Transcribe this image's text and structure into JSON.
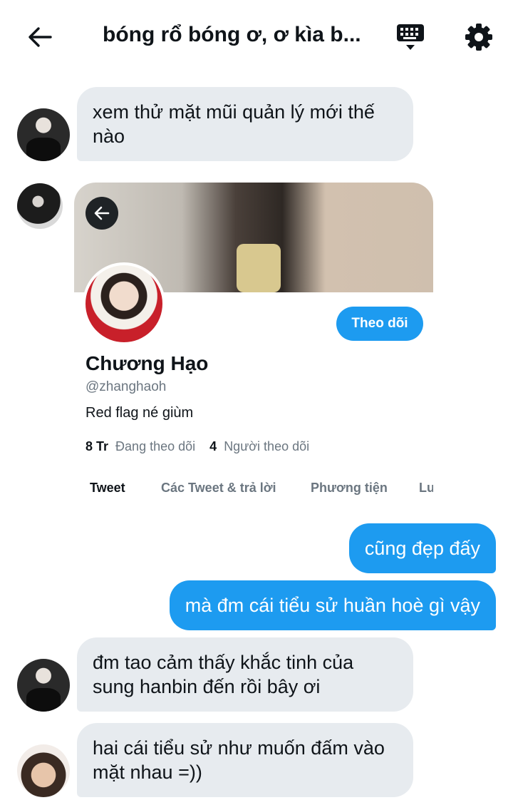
{
  "header": {
    "title": "bóng rổ bóng ơ, ơ kìa b...",
    "back_icon": "arrow-left-icon",
    "keyboard_icon": "keyboard-icon",
    "settings_icon": "gear-icon"
  },
  "messages": [
    {
      "direction": "incoming",
      "text": "xem thử mặt mũi quản lý mới thế nào"
    },
    {
      "direction": "outgoing",
      "text": "cũng đẹp đấy"
    },
    {
      "direction": "outgoing",
      "text": "mà đm cái tiểu sử huần hoè gì vậy"
    },
    {
      "direction": "incoming",
      "text": "đm tao cảm thấy khắc tinh của sung hanbin đến rồi bây ơi"
    },
    {
      "direction": "incoming",
      "text": "hai cái tiểu sử như muốn đấm vào mặt nhau =))"
    }
  ],
  "profile_card": {
    "name": "Chương Hạo",
    "handle": "@zhanghaoh",
    "bio": "Red flag né giùm",
    "following_count": "8 Tr",
    "following_label": "Đang theo dõi",
    "followers_count": "4",
    "followers_label": "Người theo dõi",
    "follow_button": "Theo dõi",
    "tabs": [
      "Tweet",
      "Các Tweet & trả lời",
      "Phương tiện",
      "Lư"
    ],
    "active_tab": "Tweet"
  },
  "colors": {
    "accent": "#1d9bf0",
    "incoming_bubble": "#e7ebef",
    "text": "#0f1419",
    "muted": "#6b7680"
  }
}
